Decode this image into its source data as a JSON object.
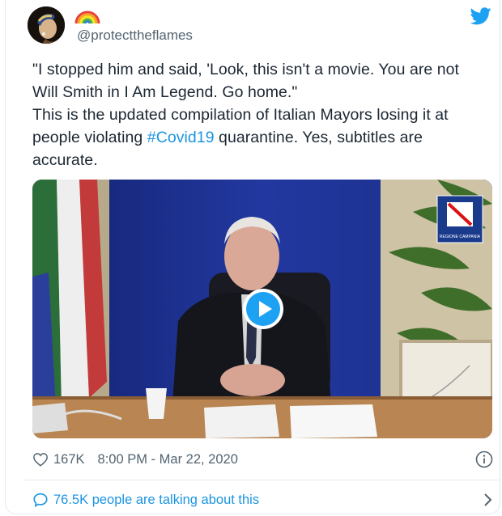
{
  "tweet": {
    "handle": "@protecttheflames",
    "text_lines": [
      "\"I stopped him and said, 'Look, this isn't a movie. You are not",
      "Will Smith in I Am Legend. Go home.\"",
      "This is the updated compilation of Italian Mayors losing it at"
    ],
    "line4_before": "people violating ",
    "hashtag": "#Covid19",
    "line4_after": " quarantine. Yes, subtitles are",
    "line5": "accurate."
  },
  "media": {
    "logo_text": "REGIONE CAMPANIA"
  },
  "footer": {
    "like_count": "167K",
    "timestamp": "8:00 PM - Mar 22, 2020",
    "talking": "76.5K people are talking about this"
  },
  "colors": {
    "link": "#1b95e0",
    "secondary_text": "#536471",
    "video_backdrop": "#1c2f8a"
  },
  "icons": [
    "rainbow-emoji",
    "twitter-bird-icon",
    "play-icon",
    "heart-icon",
    "info-icon",
    "speech-bubble-icon",
    "chevron-right-icon"
  ]
}
